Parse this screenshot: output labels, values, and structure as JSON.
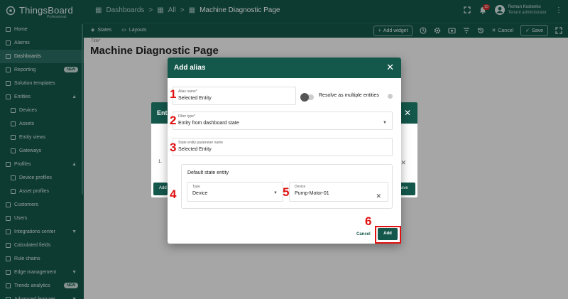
{
  "topbar": {
    "logo_text": "ThingsBoard",
    "logo_sub": "Professional",
    "breadcrumbs": [
      "Dashboards",
      "All",
      "Machine Diagnostic Page"
    ],
    "notification_count": "10",
    "user_name": "Roman Kostenko",
    "user_role": "Tenant administrator"
  },
  "toolbar": {
    "states_label": "States",
    "layouts_label": "Layouts",
    "add_widget_label": "Add widget",
    "cancel_label": "Cancel",
    "save_label": "Save"
  },
  "sidebar": {
    "items": [
      {
        "label": "Home",
        "icon": "home-icon"
      },
      {
        "label": "Alarms",
        "icon": "alarm-icon"
      },
      {
        "label": "Dashboards",
        "icon": "dashboard-icon",
        "active": true
      },
      {
        "label": "Reporting",
        "icon": "report-icon",
        "badge": "NEW"
      },
      {
        "label": "Solution templates",
        "icon": "template-icon"
      },
      {
        "label": "Entities",
        "icon": "entities-icon",
        "expanded": true
      },
      {
        "label": "Devices",
        "icon": "device-icon",
        "sub": true
      },
      {
        "label": "Assets",
        "icon": "asset-icon",
        "sub": true
      },
      {
        "label": "Entity views",
        "icon": "entity-view-icon",
        "sub": true
      },
      {
        "label": "Gateways",
        "icon": "gateway-icon",
        "sub": true
      },
      {
        "label": "Profiles",
        "icon": "profiles-icon",
        "expanded": true
      },
      {
        "label": "Device profiles",
        "icon": "device-profile-icon",
        "sub": true
      },
      {
        "label": "Asset profiles",
        "icon": "asset-profile-icon",
        "sub": true
      },
      {
        "label": "Customers",
        "icon": "customers-icon"
      },
      {
        "label": "Users",
        "icon": "users-icon"
      },
      {
        "label": "Integrations center",
        "icon": "integrations-icon",
        "collapsed": true
      },
      {
        "label": "Calculated fields",
        "icon": "calculated-icon"
      },
      {
        "label": "Rule chains",
        "icon": "rule-chain-icon"
      },
      {
        "label": "Edge management",
        "icon": "edge-icon",
        "collapsed": true
      },
      {
        "label": "Trendz analytics",
        "icon": "trendz-icon",
        "badge": "NEW"
      },
      {
        "label": "Advanced features",
        "icon": "advanced-icon",
        "collapsed": true
      }
    ]
  },
  "main": {
    "title_label": "Title*",
    "page_title": "Machine Diagnostic Page"
  },
  "bg_dialog": {
    "header_partial": "Enti",
    "row_number": "1.",
    "add_partial": "Add",
    "save_partial": "ave"
  },
  "dialog": {
    "title": "Add alias",
    "alias_name_label": "Alias name*",
    "alias_name_value": "Selected Entity",
    "resolve_label": "Resolve as multiple entities",
    "filter_type_label": "Filter type*",
    "filter_type_value": "Entity from dashboard state",
    "state_param_label": "State entity parameter name",
    "state_param_value": "Selected Entity",
    "default_state_title": "Default state entity",
    "type_label": "Type",
    "type_value": "Device",
    "device_label": "Device",
    "device_value": "Pump-Motor-01",
    "cancel_label": "Cancel",
    "add_label": "Add"
  },
  "annotations": [
    "1",
    "2",
    "3",
    "4",
    "5",
    "6"
  ],
  "colors": {
    "primary": "#14574b",
    "annotation": "#e01010"
  }
}
